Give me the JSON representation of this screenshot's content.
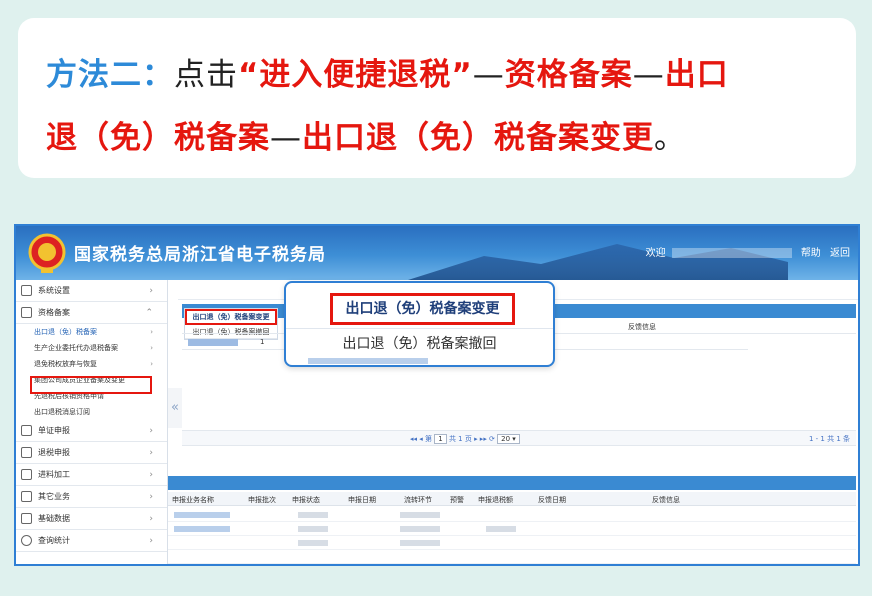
{
  "instruction": {
    "line1_method": "方法二：",
    "line1_click": "点击",
    "line1_target": "“进入便捷退税”",
    "line1_dash1": "—",
    "line1_qual": "资格备案",
    "line1_dash2": "—",
    "line1_red": "出口",
    "line2_red1": "退（免）税备案",
    "line2_dash": "—",
    "line2_red2": "出口退（免）税备案变更",
    "line2_end": "。"
  },
  "header": {
    "site_title": "国家税务总局浙江省电子税务局",
    "welcome": "欢迎",
    "help": "帮助",
    "back": "返回"
  },
  "sidebar": {
    "items": [
      {
        "label": "系统设置",
        "icon": "gear-icon"
      },
      {
        "label": "资格备案",
        "icon": "shield-icon",
        "expanded": true
      },
      {
        "label": "单证申报",
        "icon": "doc-icon"
      },
      {
        "label": "退税申报",
        "icon": "refund-icon"
      },
      {
        "label": "进料加工",
        "icon": "process-icon"
      },
      {
        "label": "其它业务",
        "icon": "calendar-icon"
      },
      {
        "label": "基础数据",
        "icon": "bar-chart-icon"
      },
      {
        "label": "查询统计",
        "icon": "search-icon"
      }
    ],
    "sub_items": [
      "出口退（免）税备案",
      "生产企业委托代办退税备案",
      "退免税权放弃与恢复",
      "集团公司成员企业备案及变更",
      "先退税后核销资格申请",
      "出口退税消息订阅"
    ]
  },
  "content": {
    "tiny_menu": [
      "出口退（免）税备案变更",
      "出口退（免）税备案撤回"
    ],
    "table_header_right": "反馈信息",
    "row1_num": "1",
    "pager": {
      "page_label_pre": "第",
      "page_value": "1",
      "page_label_post": "共 1 页",
      "page_size": "20",
      "summary": "1 - 1 共 1 条"
    },
    "grid_columns": [
      "申报业务名称",
      "申报批次",
      "申报状态",
      "申报日期",
      "流转环节",
      "预警",
      "申报退税额",
      "反馈日期",
      "反馈信息"
    ]
  },
  "popup": {
    "option1": "出口退（免）税备案变更",
    "option2": "出口退（免）税备案撤回"
  },
  "colors": {
    "accent_blue": "#2d8ad8",
    "highlight_red": "#e5170f",
    "banner_blue": "#2a6fc0"
  }
}
